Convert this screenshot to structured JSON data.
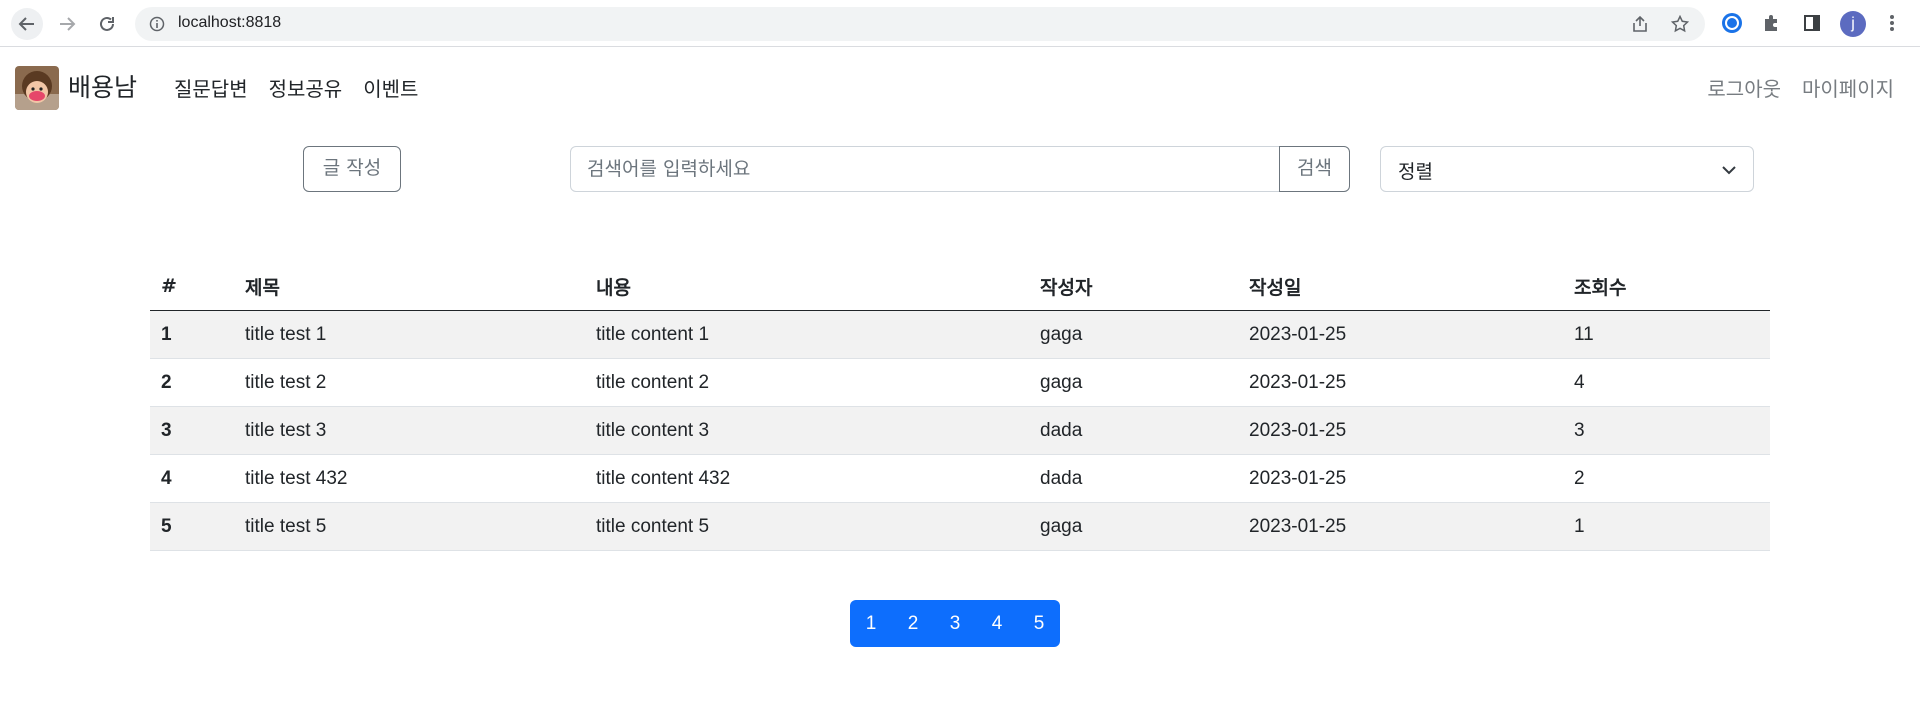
{
  "browser": {
    "url": "localhost:8818",
    "profile_initial": "j"
  },
  "navbar": {
    "brand": "배용남",
    "links": [
      "질문답변",
      "정보공유",
      "이벤트"
    ],
    "right_links": [
      "로그아웃",
      "마이페이지"
    ]
  },
  "toolbar": {
    "write_label": "글 작성",
    "search_placeholder": "검색어를 입력하세요",
    "search_label": "검색",
    "sort_value": "정렬"
  },
  "table": {
    "headers": [
      "#",
      "제목",
      "내용",
      "작성자",
      "작성일",
      "조회수"
    ],
    "rows": [
      [
        "1",
        "title test 1",
        "title content 1",
        "gaga",
        "2023-01-25",
        "11"
      ],
      [
        "2",
        "title test 2",
        "title content 2",
        "gaga",
        "2023-01-25",
        "4"
      ],
      [
        "3",
        "title test 3",
        "title content 3",
        "dada",
        "2023-01-25",
        "3"
      ],
      [
        "4",
        "title test 432",
        "title content 432",
        "dada",
        "2023-01-25",
        "2"
      ],
      [
        "5",
        "title test 5",
        "title content 5",
        "gaga",
        "2023-01-25",
        "1"
      ]
    ]
  },
  "pagination": {
    "pages": [
      "1",
      "2",
      "3",
      "4",
      "5"
    ]
  },
  "colors": {
    "primary": "#0d6efd",
    "secondary": "#6c757d",
    "striped_row": "#f2f2f2"
  }
}
